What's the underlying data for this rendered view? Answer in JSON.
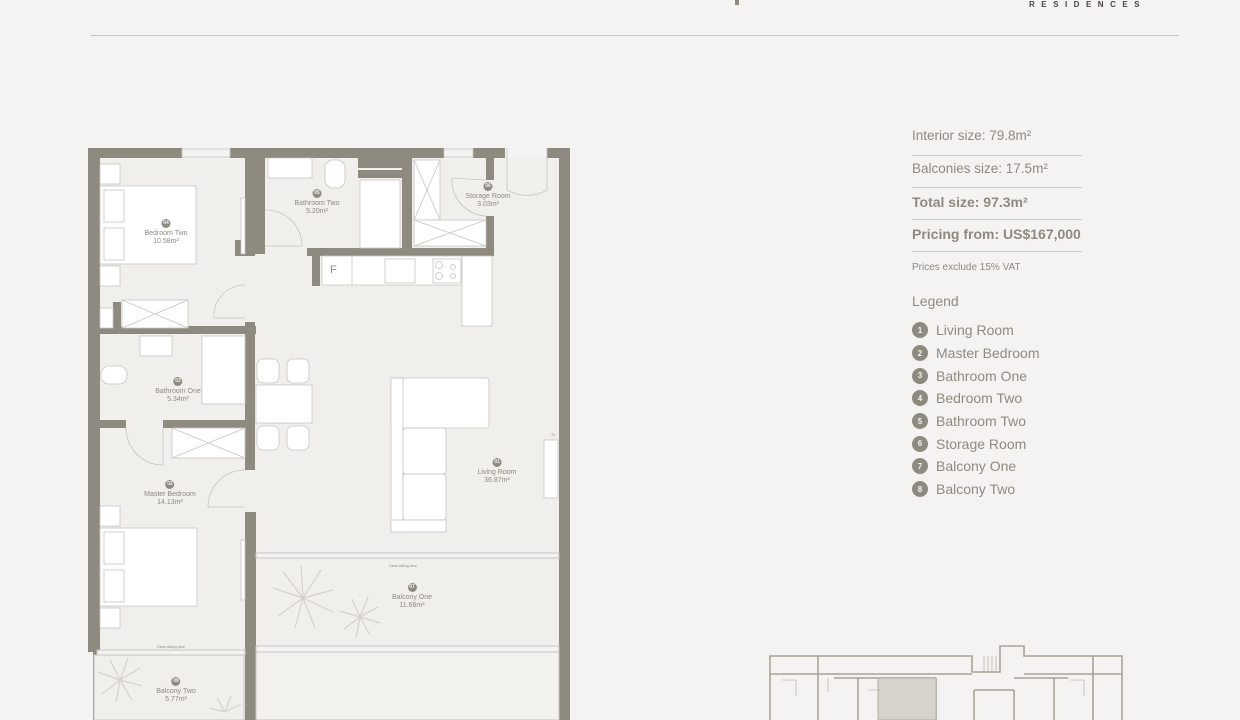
{
  "header": {
    "brand_subtitle": "RESIDENCES"
  },
  "specs": {
    "interior": "Interior size: 79.8m²",
    "balconies": "Balconies size: 17.5m²",
    "total": "Total size: 97.3m²",
    "pricing": "Pricing from: US$167,000",
    "vat_note": "Prices exclude 15% VAT"
  },
  "legend": {
    "title": "Legend",
    "items": [
      {
        "num": "1",
        "label": "Living Room"
      },
      {
        "num": "2",
        "label": "Master Bedroom"
      },
      {
        "num": "3",
        "label": "Bathroom One"
      },
      {
        "num": "4",
        "label": "Bedroom Two"
      },
      {
        "num": "5",
        "label": "Bathroom Two"
      },
      {
        "num": "6",
        "label": "Storage Room"
      },
      {
        "num": "7",
        "label": "Balcony One"
      },
      {
        "num": "8",
        "label": "Balcony Two"
      }
    ]
  },
  "rooms": {
    "living": {
      "badge": "01",
      "name": "Living Room",
      "area": "36.87m²"
    },
    "master": {
      "badge": "02",
      "name": "Master Bedroom",
      "area": "14.13m²"
    },
    "bath1": {
      "badge": "03",
      "name": "Bathroom One",
      "area": "5.34m²"
    },
    "bed2": {
      "badge": "04",
      "name": "Bedroom Two",
      "area": "10.58m²"
    },
    "bath2": {
      "badge": "05",
      "name": "Bathroom Two",
      "area": "5.20m²"
    },
    "storage": {
      "badge": "06",
      "name": "Storage Room",
      "area": "3.03m²"
    },
    "balcony1": {
      "badge": "07",
      "name": "Balcony One",
      "area": "11.66m²"
    },
    "balcony2": {
      "badge": "08",
      "name": "Balcony Two",
      "area": "5.77m²"
    }
  },
  "annotations": {
    "sliding_door": "Glass sliding door",
    "fridge": "F",
    "tv": "TV"
  },
  "colors": {
    "wall": "#8f8a80",
    "background": "#f4f3f1",
    "floor": "#f0efec",
    "furniture": "#ffffff",
    "line": "#c7c5c0"
  }
}
